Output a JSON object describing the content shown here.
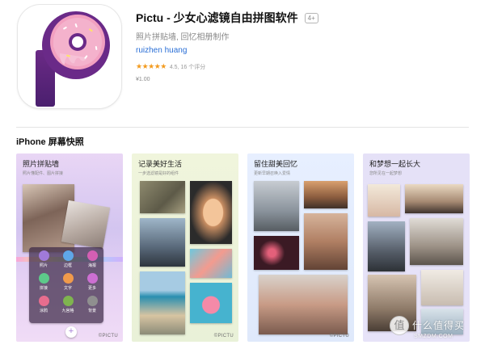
{
  "app": {
    "name": "Pictu - 少女心滤镜自由拼图软件",
    "age_rating": "4+",
    "subtitle": "照片拼贴墙, 回忆相册制作",
    "developer": "ruizhen huang",
    "stars": "★★★★★",
    "rating": "4.5, 16 个评分",
    "price": "¥1.00"
  },
  "screenshots": {
    "title": "iPhone 屏幕快照",
    "cards": [
      {
        "title": "照片拼贴墙",
        "sub": "照片懂配件、图片拼接",
        "watermark": "©PICTU"
      },
      {
        "title": "记录美好生活",
        "sub": "一步选滤镜是好的组件",
        "watermark": "©PICTU"
      },
      {
        "title": "留住甜美回忆",
        "sub": "更新早期召唤入爱情",
        "watermark": "©PICTU"
      },
      {
        "title": "和梦想一起长大",
        "sub": "您所见在一起梦想",
        "watermark": ""
      }
    ],
    "card1_icons": [
      {
        "label": "照片",
        "color": "#a07ad9"
      },
      {
        "label": "边框",
        "color": "#5fa7e8"
      },
      {
        "label": "海报",
        "color": "#d45fb3"
      },
      {
        "label": "拼接",
        "color": "#5dc98a"
      },
      {
        "label": "文字",
        "color": "#f09a4b"
      },
      {
        "label": "更多",
        "color": "#cc6fd2"
      },
      {
        "label": "涂鸦",
        "color": "#e76d8e"
      },
      {
        "label": "九宫格",
        "color": "#7fb44f"
      },
      {
        "label": "背景",
        "color": "#8f8f8f"
      }
    ],
    "plus": "+"
  },
  "watermark": {
    "badge": "值",
    "text": "什么值得买",
    "site": "SMZDM.COM"
  }
}
